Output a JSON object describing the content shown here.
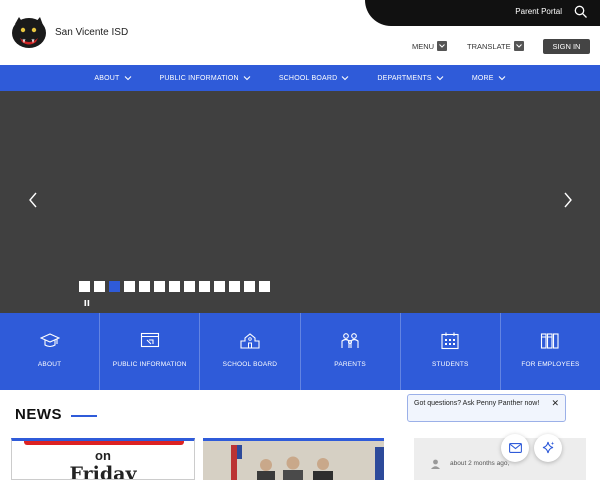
{
  "header": {
    "district_name": "San Vicente ISD",
    "parent_portal": "Parent Portal",
    "menu_label": "MENU",
    "translate_label": "TRANSLATE",
    "signin_label": "SIGN IN"
  },
  "nav": {
    "items": [
      {
        "label": "ABOUT"
      },
      {
        "label": "PUBLIC INFORMATION"
      },
      {
        "label": "SCHOOL BOARD"
      },
      {
        "label": "DEPARTMENTS"
      },
      {
        "label": "MORE"
      }
    ]
  },
  "carousel": {
    "slide_count": 13,
    "active_slide": 3
  },
  "quick_links": [
    {
      "label": "ABOUT",
      "icon": "graduation-cap-icon"
    },
    {
      "label": "PUBLIC INFORMATION",
      "icon": "monitor-icon"
    },
    {
      "label": "SCHOOL BOARD",
      "icon": "school-building-icon"
    },
    {
      "label": "PARENTS",
      "icon": "family-icon"
    },
    {
      "label": "STUDENTS",
      "icon": "calendar-icon"
    },
    {
      "label": "FOR EMPLOYEES",
      "icon": "books-icon"
    }
  ],
  "news": {
    "title": "NEWS",
    "card1": {
      "line1": "on",
      "line2": "Friday"
    },
    "card3": {
      "meta": "about 2 months ago, "
    }
  },
  "chat": {
    "text": "Got questions? Ask Penny Panther now!",
    "close": "✕"
  },
  "colors": {
    "primary": "#2f5bd9",
    "dark": "#111111",
    "carousel_bg": "#404040"
  }
}
